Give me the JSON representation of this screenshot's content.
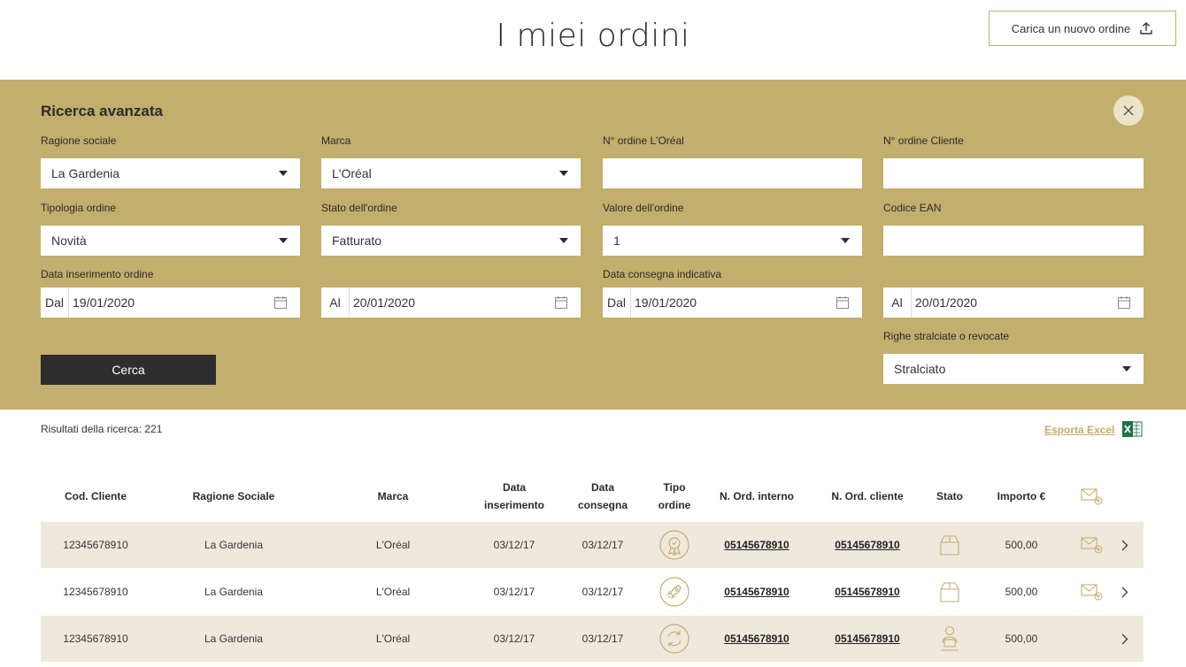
{
  "header": {
    "title": "I miei ordini",
    "upload_label": "Carica un nuovo ordine"
  },
  "search": {
    "title": "Ricerca avanzata",
    "ragione_sociale": {
      "label": "Ragione sociale",
      "value": "La Gardenia"
    },
    "marca": {
      "label": "Marca",
      "value": "L'Oréal"
    },
    "n_ordine_loreal": {
      "label": "N° ordine L'Oréal",
      "value": ""
    },
    "n_ordine_cliente": {
      "label": "N° ordine Cliente",
      "value": ""
    },
    "tipologia": {
      "label": "Tipologia ordine",
      "value": "Novità"
    },
    "stato": {
      "label": "Stato dell'ordine",
      "value": "Fatturato"
    },
    "valore": {
      "label": "Valore dell'ordine",
      "value": "1"
    },
    "ean": {
      "label": "Codice EAN",
      "value": ""
    },
    "data_inserimento": {
      "label": "Data inserimento ordine",
      "from_prefix": "Dal",
      "from": "19/01/2020",
      "to_prefix": "Al",
      "to": "20/01/2020"
    },
    "data_consegna": {
      "label": "Data consegna indicativa",
      "from_prefix": "Dal",
      "from": "19/01/2020",
      "to_prefix": "Al",
      "to": "20/01/2020"
    },
    "righe": {
      "label": "Righe stralciate o revocate",
      "value": "Stralciato"
    },
    "search_label": "Cerca"
  },
  "results": {
    "count_text": "Risultati della ricerca: 221",
    "export_label": "Esporta Excel"
  },
  "table": {
    "headers": {
      "cod_cliente": "Cod. Cliente",
      "ragione_sociale": "Ragione Sociale",
      "marca": "Marca",
      "data_ins_1": "Data",
      "data_ins_2": "inserimento",
      "data_cons_1": "Data",
      "data_cons_2": "consegna",
      "tipo_1": "Tipo",
      "tipo_2": "ordine",
      "n_ord_interno": "N. Ord. interno",
      "n_ord_cliente": "N. Ord. cliente",
      "stato": "Stato",
      "importo": "Importo €"
    },
    "rows": [
      {
        "cod": "12345678910",
        "ragione": "La Gardenia",
        "marca": "L'Oréal",
        "ins": "03/12/17",
        "cons": "03/12/17",
        "tipo_icon": "badge-icon",
        "n_int": "05145678910",
        "n_cli": "05145678910",
        "stato_icon": "open-box-icon",
        "importo": "500,00",
        "mail": true
      },
      {
        "cod": "12345678910",
        "ragione": "La Gardenia",
        "marca": "L'Oréal",
        "ins": "03/12/17",
        "cons": "03/12/17",
        "tipo_icon": "rocket-icon",
        "n_int": "05145678910",
        "n_cli": "05145678910",
        "stato_icon": "open-box-icon",
        "importo": "500,00",
        "mail": true
      },
      {
        "cod": "12345678910",
        "ragione": "La Gardenia",
        "marca": "L'Oréal",
        "ins": "03/12/17",
        "cons": "03/12/17",
        "tipo_icon": "refresh-icon",
        "n_int": "05145678910",
        "n_cli": "05145678910",
        "stato_icon": "delivery-person-icon",
        "importo": "500,00",
        "mail": false
      }
    ]
  },
  "colors": {
    "panel": "#c2ae6d",
    "row_shade": "#efe9dd",
    "button_dark": "#2e2e2e",
    "gold": "#c2ae6d"
  }
}
